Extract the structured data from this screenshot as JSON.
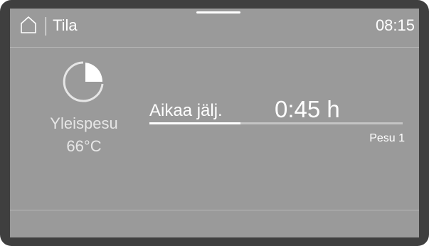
{
  "header": {
    "home_icon": "home-icon",
    "title": "Tila",
    "time": "08:15"
  },
  "program": {
    "icon": "program-phase-icon",
    "name": "Yleispesu",
    "temperature": "66°C"
  },
  "status": {
    "remaining_label": "Aikaa jälj.",
    "remaining_time": "0:45 h",
    "progress_fraction": 0.36,
    "phase": "Pesu 1"
  },
  "colors": {
    "screen_background": "#9a9a9a",
    "bezel": "#3f3f3f",
    "text": "#ffffff"
  }
}
